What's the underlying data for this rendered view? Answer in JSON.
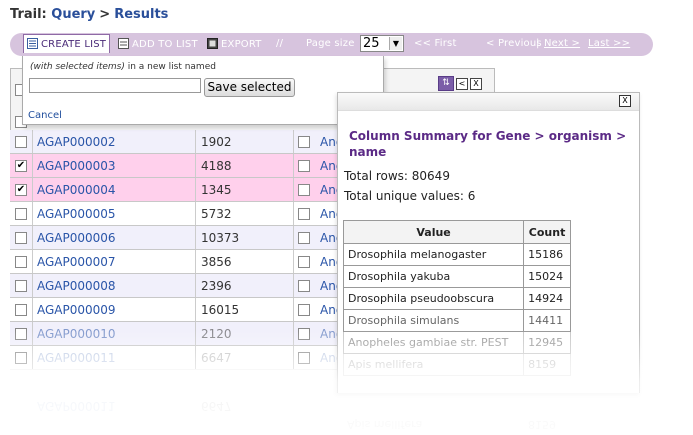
{
  "trail": {
    "label": "Trail:",
    "items": [
      "Query",
      "Results"
    ],
    "separator": ">"
  },
  "toolbar": {
    "create_list": "CREATE LIST",
    "add_to_list": "ADD TO LIST",
    "export": "EXPORT",
    "divider": "//",
    "page_size_label": "Page size",
    "page_size_value": "25",
    "first": "<< First",
    "previous": "< Previous",
    "pipe": "|",
    "next": "Next >",
    "last": "Last >>"
  },
  "create_popup": {
    "hint_italic": "(with selected items)",
    "hint_rest": " in a new list named",
    "input_value": "",
    "save_button": "Save selected",
    "cancel": "Cancel"
  },
  "rows": [
    {
      "id": "AGAP000002",
      "value": "1902",
      "org": "And",
      "checked": false,
      "style": "alt"
    },
    {
      "id": "AGAP000003",
      "value": "4188",
      "org": "And",
      "checked": true,
      "style": "sel"
    },
    {
      "id": "AGAP000004",
      "value": "1345",
      "org": "And",
      "checked": true,
      "style": "sel"
    },
    {
      "id": "AGAP000005",
      "value": "5732",
      "org": "And",
      "checked": false,
      "style": ""
    },
    {
      "id": "AGAP000006",
      "value": "10373",
      "org": "And",
      "checked": false,
      "style": "alt"
    },
    {
      "id": "AGAP000007",
      "value": "3856",
      "org": "And",
      "checked": false,
      "style": ""
    },
    {
      "id": "AGAP000008",
      "value": "2396",
      "org": "And",
      "checked": false,
      "style": "alt"
    },
    {
      "id": "AGAP000009",
      "value": "16015",
      "org": "And",
      "checked": false,
      "style": ""
    },
    {
      "id": "AGAP000010",
      "value": "2120",
      "org": "And",
      "checked": false,
      "style": "alt faded"
    },
    {
      "id": "AGAP000011",
      "value": "6647",
      "org": "And",
      "checked": false,
      "style": "faded2"
    }
  ],
  "summary": {
    "close": "X",
    "title": "Column Summary for Gene > organism > name",
    "total_rows": "Total rows: 80649",
    "total_unique": "Total unique values: 6",
    "col_value": "Value",
    "col_count": "Count",
    "items": [
      {
        "value": "Drosophila melanogaster",
        "count": "15186"
      },
      {
        "value": "Drosophila yakuba",
        "count": "15024"
      },
      {
        "value": "Drosophila pseudoobscura",
        "count": "14924"
      },
      {
        "value": "Drosophila simulans",
        "count": "14411"
      },
      {
        "value": "Anopheles gambiae str. PEST",
        "count": "12945"
      },
      {
        "value": "Apis mellifera",
        "count": "8159"
      }
    ]
  },
  "header_controls": {
    "sort": "⇅",
    "collapse": "<",
    "close": "X"
  }
}
